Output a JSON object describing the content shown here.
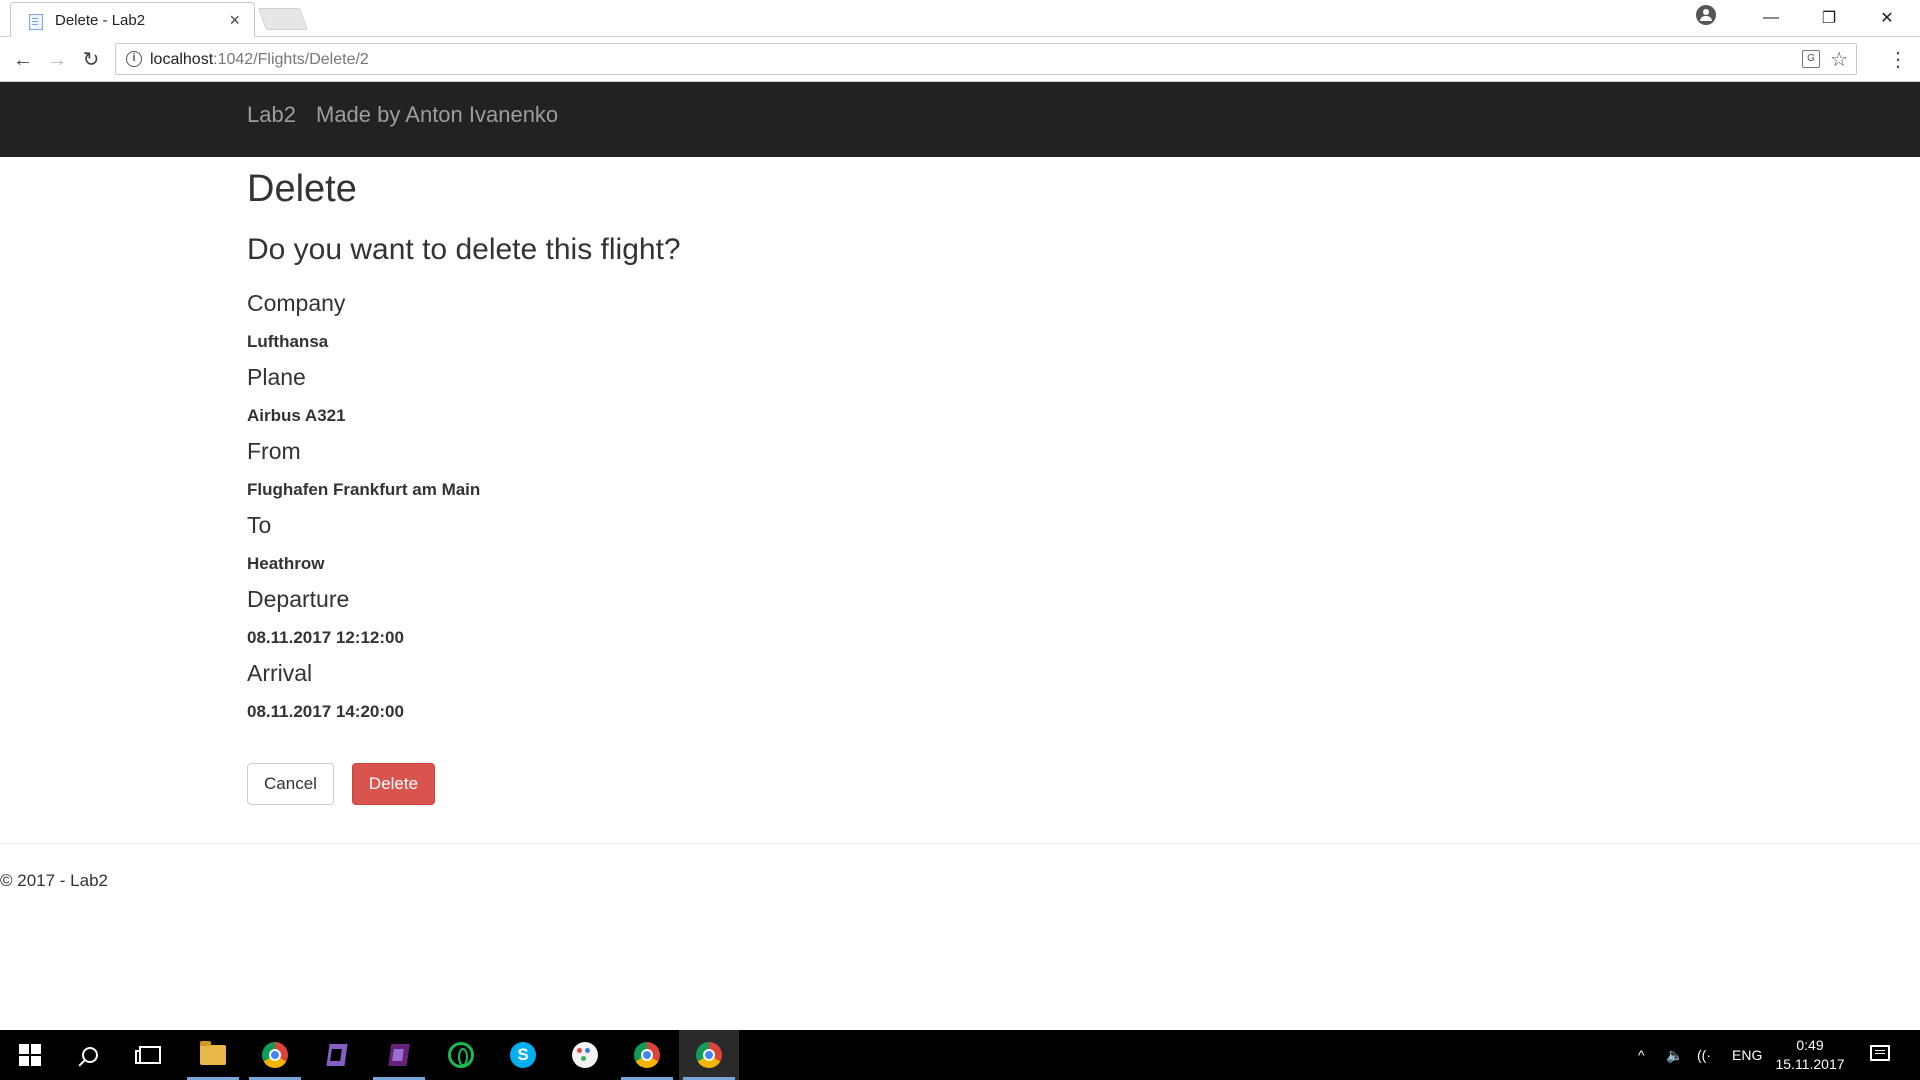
{
  "browser": {
    "tab_title": "Delete - Lab2",
    "tab_close": "×",
    "url_host": "localhost",
    "url_path": ":1042/Flights/Delete/2",
    "back": "←",
    "forward": "→",
    "reload": "↻",
    "star": "☆",
    "menu": "⋮",
    "minimize": "—",
    "restore": "❐",
    "close": "✕",
    "icons": [
      "favicon-icon",
      "profile-icon",
      "info-icon",
      "translate-icon",
      "star-icon",
      "menu-icon"
    ]
  },
  "navbar": {
    "brand": "Lab2",
    "link": "Made by Anton Ivanenko"
  },
  "page": {
    "title": "Delete",
    "question": "Do you want to delete this flight?",
    "fields": [
      {
        "label": "Company",
        "value": "Lufthansa"
      },
      {
        "label": "Plane",
        "value": "Airbus A321"
      },
      {
        "label": "From",
        "value": "Flughafen Frankfurt am Main"
      },
      {
        "label": "To",
        "value": "Heathrow"
      },
      {
        "label": "Departure",
        "value": "08.11.2017 12:12:00"
      },
      {
        "label": "Arrival",
        "value": "08.11.2017 14:20:00"
      }
    ],
    "cancel_label": "Cancel",
    "delete_label": "Delete",
    "footer": "© 2017 - Lab2"
  },
  "colors": {
    "navbar_bg": "#222222",
    "navbar_text": "#9d9d9d",
    "danger": "#d9534f"
  },
  "taskbar": {
    "apps": [
      "start-icon",
      "search-icon",
      "task-view-icon",
      "file-explorer-icon",
      "chrome-icon",
      "visual-studio-icon",
      "visual-studio-alt-icon",
      "ring-app-icon",
      "skype-icon",
      "paint-icon",
      "chrome-icon",
      "chrome-icon"
    ],
    "skype_glyph": "S",
    "tray_chevron": "^",
    "tray_volume": "🔈",
    "tray_wifi": "((·",
    "language": "ENG",
    "time": "0:49",
    "date": "15.11.2017"
  }
}
